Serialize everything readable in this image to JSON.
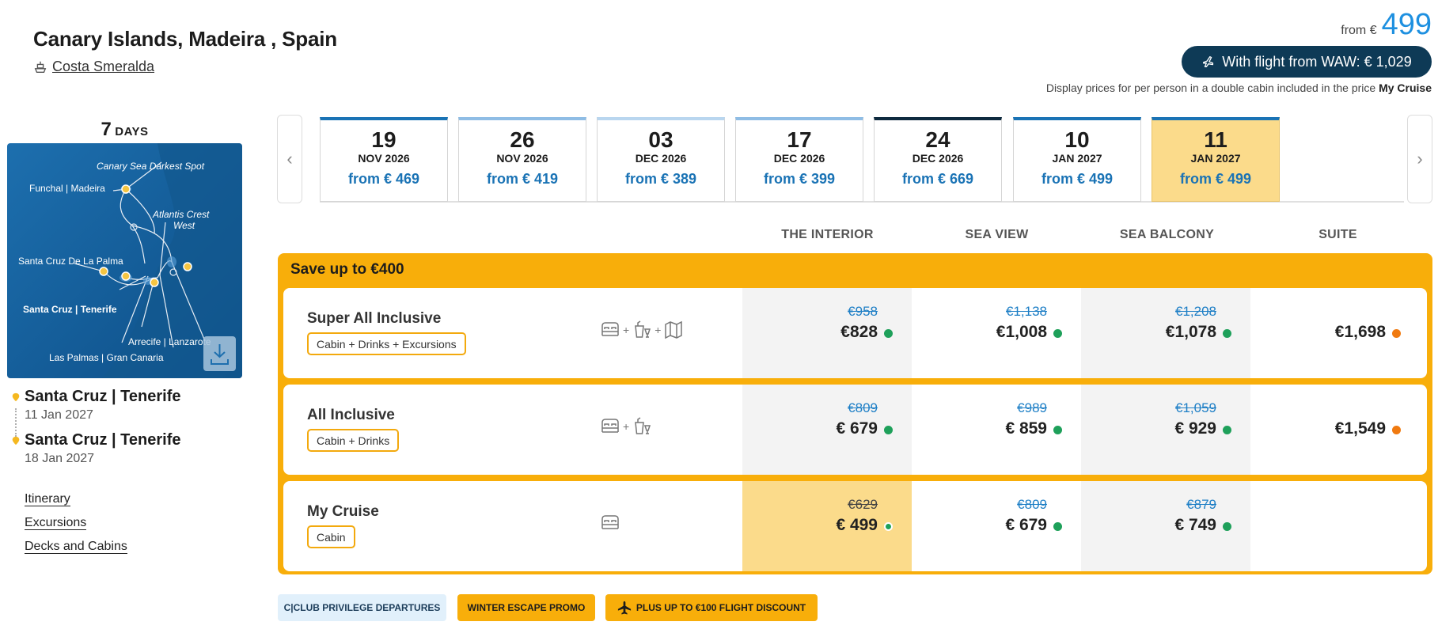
{
  "header": {
    "title": "Canary Islands, Madeira , Spain",
    "ship": "Costa Smeralda",
    "from_label": "from €",
    "from_price": "499",
    "flight_button": "With flight from WAW: € 1,029",
    "display_note": "Display prices for per person in a double cabin included in the price",
    "display_note_bold": "My Cruise"
  },
  "itinerary": {
    "days_num": "7",
    "days_label": "DAYS",
    "map_labels": {
      "canary": "Canary Sea Darkest Spot",
      "funchal": "Funchal | Madeira",
      "atlantis": "Atlantis Crest",
      "atlantis2": "West",
      "santacruzpalma": "Santa Cruz De La Palma",
      "tenerife": "Santa Cruz | Tenerife",
      "arrecife": "Arrecife | Lanzarote",
      "laspalmas": "Las Palmas | Gran Canaria"
    },
    "start_port": "Santa Cruz | Tenerife",
    "start_date": "11 Jan 2027",
    "end_port": "Santa Cruz | Tenerife",
    "end_date": "18 Jan 2027",
    "links": [
      "Itinerary",
      "Excursions",
      "Decks and Cabins"
    ]
  },
  "dates": [
    {
      "day": "19",
      "month": "NOV 2026",
      "price": "from € 469",
      "color": "#1a73b5"
    },
    {
      "day": "26",
      "month": "NOV 2026",
      "price": "from € 419",
      "color": "#8fbde5"
    },
    {
      "day": "03",
      "month": "DEC 2026",
      "price": "from € 389",
      "color": "#b9d6ef"
    },
    {
      "day": "17",
      "month": "DEC 2026",
      "price": "from € 399",
      "color": "#8fbde5"
    },
    {
      "day": "24",
      "month": "DEC 2026",
      "price": "from € 669",
      "color": "#0e2a3f"
    },
    {
      "day": "10",
      "month": "JAN 2027",
      "price": "from € 499",
      "color": "#1a73b5"
    },
    {
      "day": "11",
      "month": "JAN 2027",
      "price": "from € 499",
      "color": "#1a73b5"
    }
  ],
  "cabins": [
    "THE INTERIOR",
    "SEA VIEW",
    "SEA BALCONY",
    "SUITE"
  ],
  "save_title": "Save up to €400",
  "packages": [
    {
      "name": "Super All Inclusive",
      "tag": "Cabin + Drinks + Excursions",
      "prices": [
        {
          "old": "€958",
          "now": "€828",
          "status": "#1ea05a"
        },
        {
          "old": "€1,138",
          "now": "€1,008",
          "status": "#1ea05a"
        },
        {
          "old": "€1,208",
          "now": "€1,078",
          "status": "#1ea05a"
        },
        {
          "old": "",
          "now": "€1,698",
          "status": "#f07a10"
        }
      ]
    },
    {
      "name": "All Inclusive",
      "tag": "Cabin + Drinks",
      "prices": [
        {
          "old": "€809",
          "now": "€ 679",
          "status": "#1ea05a"
        },
        {
          "old": "€989",
          "now": "€ 859",
          "status": "#1ea05a"
        },
        {
          "old": "€1,059",
          "now": "€ 929",
          "status": "#1ea05a"
        },
        {
          "old": "",
          "now": "€1,549",
          "status": "#f07a10"
        }
      ]
    },
    {
      "name": "My Cruise",
      "tag": "Cabin",
      "prices": [
        {
          "old": "€629",
          "now": "€ 499",
          "status": "#1ea05a"
        },
        {
          "old": "€809",
          "now": "€ 679",
          "status": "#1ea05a"
        },
        {
          "old": "€879",
          "now": "€ 749",
          "status": "#1ea05a"
        }
      ]
    }
  ],
  "badges": {
    "club": "C|CLUB PRIVILEGE DEPARTURES",
    "winter": "WINTER ESCAPE PROMO",
    "flight": "PLUS UP TO €100 FLIGHT DISCOUNT"
  },
  "colors": {
    "accent_blue": "#1e90e0",
    "navy": "#0e3a56",
    "promo_orange": "#f8ae0a",
    "highlight": "#fbdb8b"
  }
}
